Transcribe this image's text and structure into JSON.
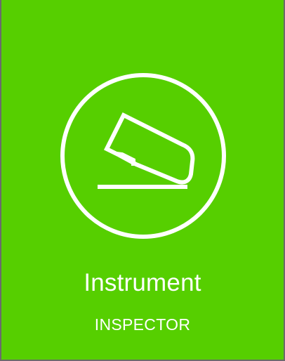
{
  "tile": {
    "title": "Instrument",
    "subtitle": "INSPECTOR",
    "icon": "stapler-icon",
    "background_color": "#56cf00",
    "foreground_color": "#ffffff"
  }
}
